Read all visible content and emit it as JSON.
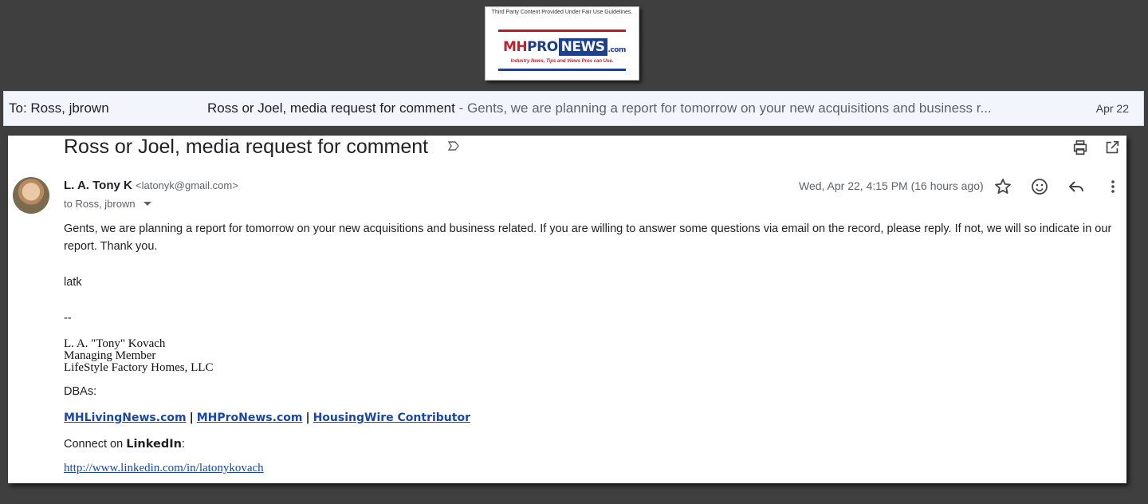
{
  "watermark": {
    "caption": "Third Party Content Provided Under Fair Use Guidelines.",
    "mh": "MH",
    "pro": "PRO",
    "news": "NEWS",
    "com": ".com",
    "tagline": "Industry News, Tips and Views Pros can Use."
  },
  "list_row": {
    "to": "To: Ross, jbrown",
    "subject": "Ross or Joel, media request for comment",
    "snippet": " - Gents, we are planning a report for tomorrow on your new acquisitions and business r...",
    "date": "Apr 22"
  },
  "message": {
    "subject": "Ross or Joel, media request for comment",
    "sender_name": "L. A. Tony K",
    "sender_email": "<latonyk@gmail.com>",
    "recipients": "to Ross, jbrown",
    "datetime": "Wed, Apr 22, 4:15 PM (16 hours ago)",
    "body_p1": "Gents, we are planning a report for tomorrow on your new acquisitions and business related. If you are willing to answer some questions via email on the record, please reply. If not, we will so indicate in our report. Thank you.",
    "body_latk": "latk",
    "body_dash": "--",
    "sig_line1": "L. A. \"Tony\" Kovach",
    "sig_line2": "Managing Member",
    "sig_line3": "LifeStyle Factory Homes, LLC",
    "dbas": "DBAs:",
    "link1": "MHLivingNews.com",
    "sep1": "|",
    "link2": "MHProNews.com",
    "sep2": "|",
    "link3": "HousingWire Contributor",
    "connect_prefix": "Connect on ",
    "connect_bold": "LinkedIn",
    "connect_suffix": ":",
    "linkedin_url": "http://www.linkedin.com/in/latonykovach"
  },
  "icons": [
    "label-icon",
    "print-icon",
    "popout-icon",
    "star-icon",
    "emoji-icon",
    "reply-icon",
    "more-icon"
  ]
}
